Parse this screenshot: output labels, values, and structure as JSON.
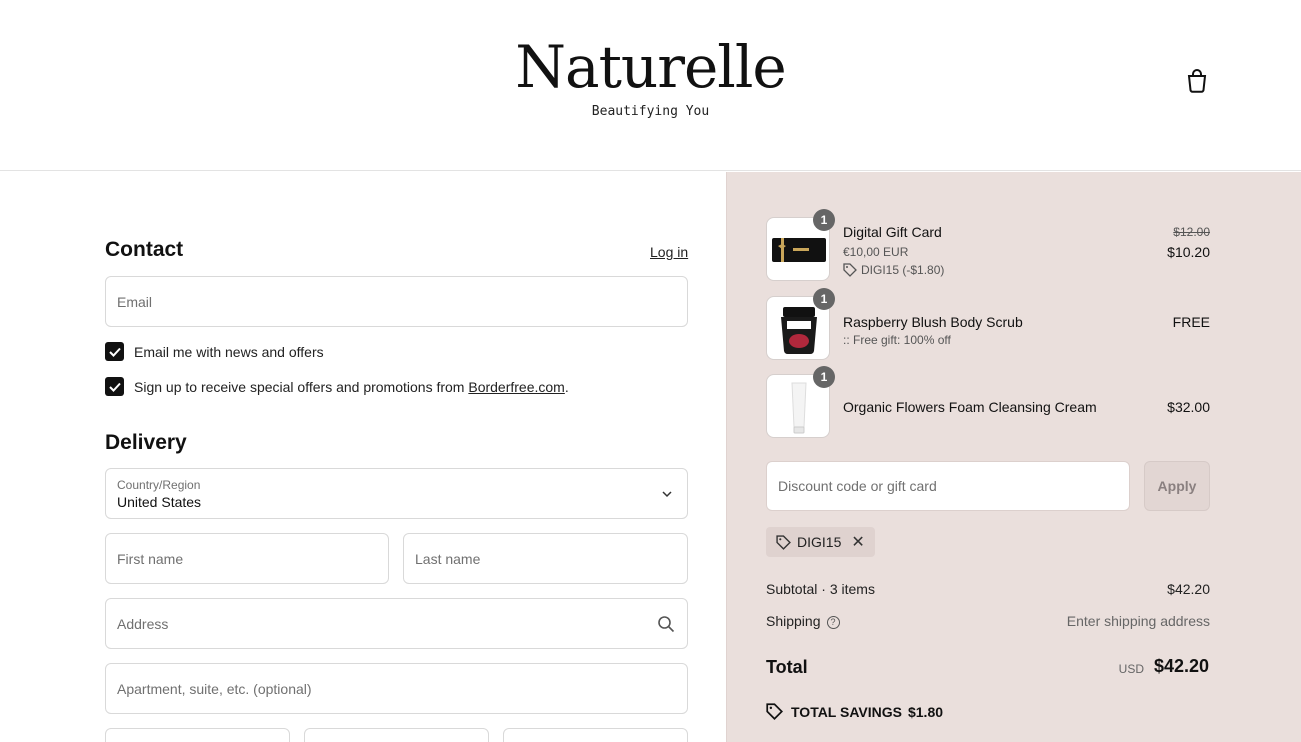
{
  "header": {
    "logo": "Naturelle",
    "tagline": "Beautifying You"
  },
  "contact": {
    "title": "Contact",
    "login_label": "Log in",
    "email_placeholder": "Email",
    "news_checkbox_label": "Email me with news and offers",
    "promo_checkbox_label_prefix": "Sign up to receive special offers and promotions from ",
    "promo_checkbox_link": "Borderfree.com",
    "promo_checkbox_suffix": "."
  },
  "delivery": {
    "title": "Delivery",
    "country_label": "Country/Region",
    "country_value": "United States",
    "first_name_placeholder": "First name",
    "last_name_placeholder": "Last name",
    "address_placeholder": "Address",
    "apartment_placeholder": "Apartment, suite, etc. (optional)"
  },
  "order": {
    "items": [
      {
        "qty": "1",
        "name": "Digital Gift Card",
        "sub": "€10,00 EUR",
        "discount": "DIGI15 (-$1.80)",
        "old_price": "$12.00",
        "price": "$10.20"
      },
      {
        "qty": "1",
        "name": "Raspberry Blush Body Scrub",
        "sub": ":: Free gift: 100% off",
        "price": "FREE"
      },
      {
        "qty": "1",
        "name": "Organic Flowers Foam Cleansing Cream",
        "price": "$32.00"
      }
    ],
    "discount_placeholder": "Discount code or gift card",
    "apply_label": "Apply",
    "applied_code": "DIGI15",
    "subtotal_label": "Subtotal · 3 items",
    "subtotal_value": "$42.20",
    "shipping_label": "Shipping",
    "shipping_value": "Enter shipping address",
    "total_label": "Total",
    "total_currency": "USD",
    "total_value": "$42.20",
    "savings_label": "TOTAL SAVINGS",
    "savings_value": "$1.80"
  },
  "colors": {
    "summary_bg": "#eadfdc",
    "checkbox": "#111111"
  }
}
